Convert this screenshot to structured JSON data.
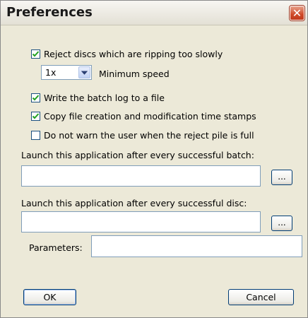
{
  "window": {
    "title": "Preferences",
    "close_glyph": "✕"
  },
  "options": {
    "reject_slow": {
      "label": "Reject discs which are ripping too slowly",
      "checked": true
    },
    "minimum_speed": {
      "value": "1x",
      "label": "Minimum speed"
    },
    "batch_log": {
      "label": "Write the batch log to a file",
      "checked": true
    },
    "copy_timestamps": {
      "label": "Copy file creation and modification time stamps",
      "checked": true
    },
    "no_warn_reject_full": {
      "label": "Do not warn the user when the reject pile is full",
      "checked": false
    }
  },
  "launch_batch": {
    "label": "Launch this application after every successful batch:",
    "value": "",
    "browse_label": "..."
  },
  "launch_disc": {
    "label": "Launch this application after every successful disc:",
    "value": "",
    "browse_label": "..."
  },
  "parameters": {
    "label": "Parameters:",
    "value": ""
  },
  "buttons": {
    "ok": "OK",
    "cancel": "Cancel"
  },
  "colors": {
    "close_red": "#cf4a2a",
    "dialog_bg": "#ece9d8",
    "checkmark": "#21a121"
  }
}
